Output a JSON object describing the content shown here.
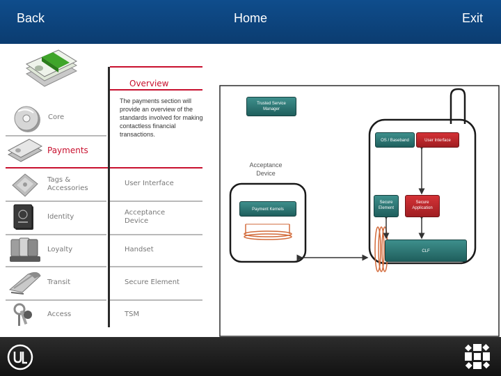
{
  "header": {
    "back_label": "Back",
    "home_label": "Home",
    "exit_label": "Exit"
  },
  "menu": {
    "items": [
      {
        "label": "Core",
        "icon": "compact-disc-icon"
      },
      {
        "label": "Payments",
        "icon": "banknote-icon",
        "active": true
      },
      {
        "label": "Tags & Accessories",
        "icon": "contactless-card-icon"
      },
      {
        "label": "Identity",
        "icon": "passport-icon"
      },
      {
        "label": "Loyalty",
        "icon": "loyalty-cards-icon"
      },
      {
        "label": "Transit",
        "icon": "train-icon"
      },
      {
        "label": "Access",
        "icon": "keys-icon"
      }
    ],
    "header_icon": "money-stack-icon"
  },
  "overview": {
    "title": "Overview",
    "description": "The payments section will provide an overview of the standards involved for making contactless financial transactions."
  },
  "submenu": {
    "items": [
      "User Interface",
      "Acceptance Device",
      "Handset",
      "Secure Element",
      "TSM"
    ]
  },
  "diagram": {
    "tsm_label": "Trusted Service Manager",
    "os_baseband_label": "OS / Baseband",
    "user_interface_label": "User Interface",
    "acceptance_device_label": "Acceptance Device",
    "payment_kernels_label": "Payment Kernels",
    "secure_element_label": "Secure Element",
    "secure_application_label": "Secure Application",
    "clf_label": "CLF"
  },
  "colors": {
    "header": "#0f4d8c",
    "accent_red": "#c8102e",
    "teal": "#2e7774"
  }
}
